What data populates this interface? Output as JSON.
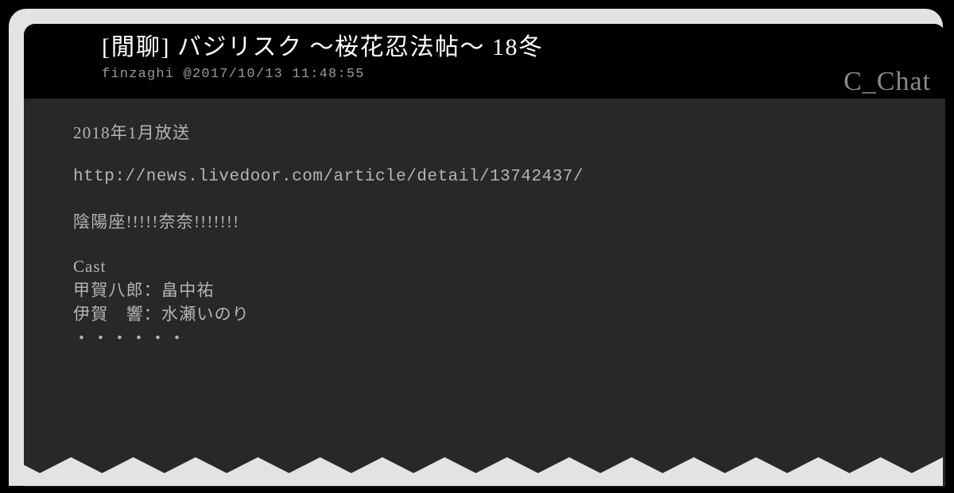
{
  "window": {
    "background_color": "#000000",
    "frame_color": "#e3e3e3",
    "header_color": "#000000",
    "body_color": "#282828",
    "text_color": "#b5b5b5"
  },
  "header": {
    "title": "[閒聊] バジリスク ～桜花忍法帖～ 18冬",
    "meta": "finzaghi @2017/10/13 11:48:55",
    "author": "finzaghi",
    "timestamp": "@2017/10/13 11:48:55",
    "board": "C_Chat"
  },
  "body": {
    "line_air_date": "2018年1月放送",
    "line_url": "http://news.livedoor.com/article/detail/13742437/",
    "line_hype": "陰陽座!!!!!奈奈!!!!!!!",
    "cast_heading": "Cast",
    "cast": [
      "甲賀八郎：畠中祐",
      "伊賀　響：水瀬いのり"
    ],
    "line_ellipsis": "・・・・・・"
  },
  "decoration": {
    "zigzag_teeth": 15,
    "zigzag_color": "#e3e3e3"
  }
}
